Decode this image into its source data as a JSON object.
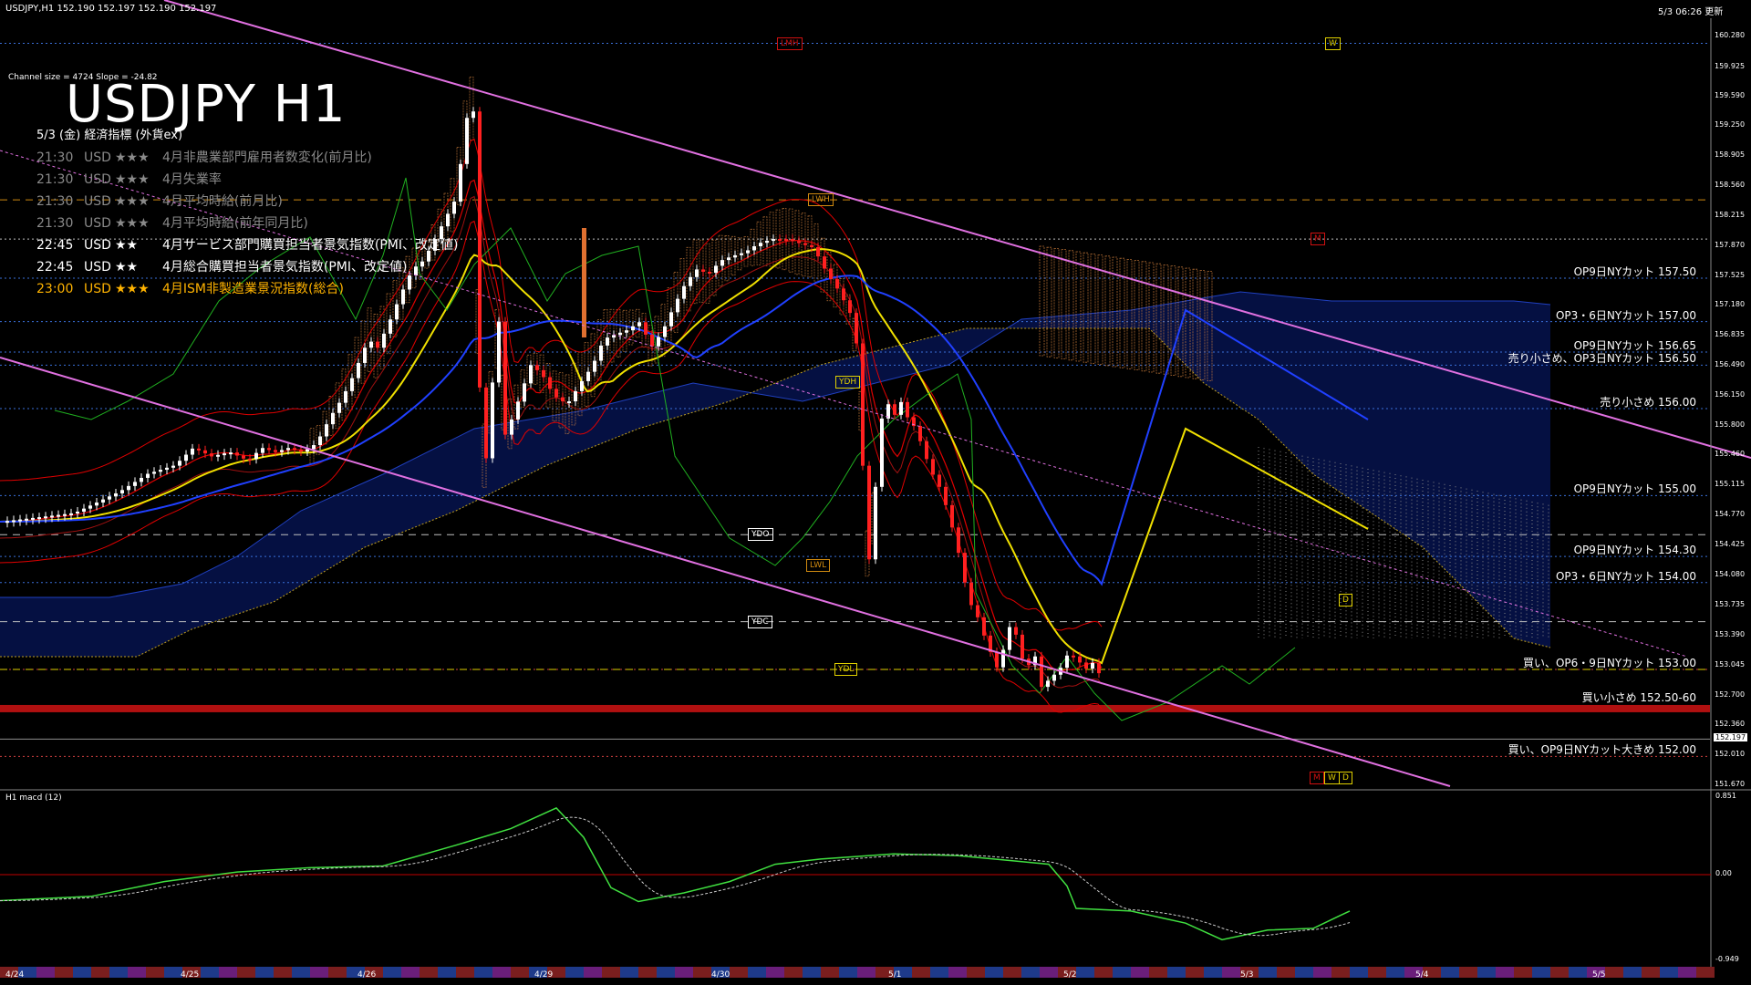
{
  "header": {
    "symbol_line": "USDJPY,H1  152.190 152.197 152.190 152.197",
    "updated": "5/3 06:26 更新"
  },
  "chart_title": "USDJPY H1",
  "channel_info": "Channel size = 4724 Slope = -24.82",
  "events": {
    "heading": "5/3 (金) 経済指標 (外貨ex)",
    "rows": [
      {
        "time": "21:30",
        "currency": "USD",
        "stars": "★★★",
        "name": "4月非農業部門雇用者数変化(前月比)",
        "state": "dim"
      },
      {
        "time": "21:30",
        "currency": "USD",
        "stars": "★★★",
        "name": "4月失業率",
        "state": "dim"
      },
      {
        "time": "21:30",
        "currency": "USD",
        "stars": "★★★",
        "name": "4月平均時給(前月比)",
        "state": "dim"
      },
      {
        "time": "21:30",
        "currency": "USD",
        "stars": "★★★",
        "name": "4月平均時給(前年同月比)",
        "state": "dim"
      },
      {
        "time": "22:45",
        "currency": "USD",
        "stars": "★★",
        "name": "4月サービス部門購買担当者景気指数(PMI、改定値)",
        "state": "bright"
      },
      {
        "time": "22:45",
        "currency": "USD",
        "stars": "★★",
        "name": "4月総合購買担当者景気指数(PMI、改定値)",
        "state": "bright"
      },
      {
        "time": "23:00",
        "currency": "USD",
        "stars": "★★★",
        "name": "4月ISM非製造業景況指数(総合)",
        "state": "amber"
      }
    ]
  },
  "order_labels": [
    {
      "price": 157.5,
      "text": "OP9日NYカット 157.50"
    },
    {
      "price": 157.0,
      "text": "OP3・6日NYカット 157.00"
    },
    {
      "price": 156.65,
      "text": "OP9日NYカット 156.65"
    },
    {
      "price": 156.5,
      "text": "売り小さめ、OP3日NYカット 156.50"
    },
    {
      "price": 156.0,
      "text": "売り小さめ 156.00"
    },
    {
      "price": 155.0,
      "text": "OP9日NYカット 155.00"
    },
    {
      "price": 154.3,
      "text": "OP9日NYカット 154.30"
    },
    {
      "price": 154.0,
      "text": "OP3・6日NYカット 154.00"
    },
    {
      "price": 153.0,
      "text": "買い、OP6・9日NYカット 153.00"
    },
    {
      "price": 152.6,
      "text": "買い小さめ 152.50-60"
    },
    {
      "price": 152.0,
      "text": "買い、OP9日NYカット大きめ 152.00"
    }
  ],
  "level_tags": [
    {
      "text": "LMH",
      "color": "#d01010",
      "price": 160.2
    },
    {
      "text": "LWH",
      "color": "#d08a10",
      "price": 158.4
    },
    {
      "text": "YDH",
      "color": "#e0d000",
      "price": 156.3
    },
    {
      "text": "YDO",
      "color": "#ffffff",
      "price": 154.55
    },
    {
      "text": "LWL",
      "color": "#d08a10",
      "price": 154.2
    },
    {
      "text": "YDC",
      "color": "#ffffff",
      "price": 153.55
    },
    {
      "text": "YDL",
      "color": "#e0d000",
      "price": 153.0
    },
    {
      "text": "W",
      "color": "#e0d000",
      "price": 160.2
    },
    {
      "text": "M",
      "color": "#d01010",
      "price": 157.95
    },
    {
      "text": "D",
      "color": "#e0d000",
      "price": 153.8
    },
    {
      "text": "M",
      "color": "#d01010",
      "price": 151.75
    },
    {
      "text": "W",
      "color": "#e0d000",
      "price": 151.75
    },
    {
      "text": "D",
      "color": "#e0d000",
      "price": 151.75
    }
  ],
  "current_price": "152.197",
  "macd": {
    "title": "H1  macd (12)",
    "ticks": [
      "0.851",
      "0.00",
      "-0.949"
    ]
  },
  "chart_data": {
    "type": "candlestick",
    "symbol": "USDJPY",
    "timeframe": "H1",
    "ylim": [
      151.7,
      160.3
    ],
    "price_ticks": [
      "160.280",
      "159.925",
      "159.590",
      "159.250",
      "158.905",
      "158.560",
      "158.215",
      "157.870",
      "157.525",
      "157.180",
      "156.835",
      "156.490",
      "156.150",
      "155.800",
      "155.460",
      "155.115",
      "154.770",
      "154.425",
      "154.080",
      "153.735",
      "153.390",
      "153.045",
      "152.700",
      "152.360",
      "152.010",
      "151.670"
    ],
    "x_ticks": [
      "4/24",
      "4/25",
      "4/26",
      "4/29",
      "4/30",
      "5/1",
      "5/2",
      "5/3",
      "5/4",
      "5/5"
    ],
    "close_path": [
      [
        0,
        154.7
      ],
      [
        40,
        154.75
      ],
      [
        80,
        154.8
      ],
      [
        100,
        154.9
      ],
      [
        130,
        155.05
      ],
      [
        160,
        155.25
      ],
      [
        190,
        155.35
      ],
      [
        210,
        155.55
      ],
      [
        230,
        155.45
      ],
      [
        250,
        155.5
      ],
      [
        270,
        155.4
      ],
      [
        285,
        155.55
      ],
      [
        300,
        155.5
      ],
      [
        315,
        155.55
      ],
      [
        330,
        155.5
      ],
      [
        345,
        155.6
      ],
      [
        360,
        155.9
      ],
      [
        372,
        156.1
      ],
      [
        382,
        156.3
      ],
      [
        392,
        156.55
      ],
      [
        402,
        156.8
      ],
      [
        412,
        156.7
      ],
      [
        425,
        157.0
      ],
      [
        437,
        157.3
      ],
      [
        450,
        157.6
      ],
      [
        462,
        157.7
      ],
      [
        475,
        157.95
      ],
      [
        487,
        158.2
      ],
      [
        497,
        158.4
      ],
      [
        505,
        158.95
      ],
      [
        512,
        159.5
      ],
      [
        518,
        159.4
      ],
      [
        523,
        156.4
      ],
      [
        530,
        155.3
      ],
      [
        537,
        156.2
      ],
      [
        545,
        157.0
      ],
      [
        552,
        155.7
      ],
      [
        560,
        155.9
      ],
      [
        570,
        156.2
      ],
      [
        580,
        156.5
      ],
      [
        592,
        156.4
      ],
      [
        605,
        156.15
      ],
      [
        620,
        156.05
      ],
      [
        635,
        156.3
      ],
      [
        648,
        156.5
      ],
      [
        660,
        156.8
      ],
      [
        672,
        156.85
      ],
      [
        685,
        156.9
      ],
      [
        700,
        157.0
      ],
      [
        712,
        156.7
      ],
      [
        725,
        156.9
      ],
      [
        738,
        157.2
      ],
      [
        750,
        157.45
      ],
      [
        762,
        157.6
      ],
      [
        775,
        157.55
      ],
      [
        788,
        157.7
      ],
      [
        800,
        157.75
      ],
      [
        815,
        157.8
      ],
      [
        830,
        157.9
      ],
      [
        845,
        157.95
      ],
      [
        860,
        157.95
      ],
      [
        875,
        157.9
      ],
      [
        890,
        157.85
      ],
      [
        905,
        157.55
      ],
      [
        918,
        157.35
      ],
      [
        930,
        157.1
      ],
      [
        940,
        156.6
      ],
      [
        947,
        154.4
      ],
      [
        953,
        154.2
      ],
      [
        958,
        155.1
      ],
      [
        963,
        155.8
      ],
      [
        970,
        156.1
      ],
      [
        978,
        155.9
      ],
      [
        985,
        156.1
      ],
      [
        993,
        155.9
      ],
      [
        1000,
        155.8
      ],
      [
        1008,
        155.6
      ],
      [
        1018,
        155.3
      ],
      [
        1028,
        155.1
      ],
      [
        1038,
        154.8
      ],
      [
        1050,
        154.3
      ],
      [
        1060,
        153.8
      ],
      [
        1070,
        153.6
      ],
      [
        1080,
        153.3
      ],
      [
        1092,
        153.0
      ],
      [
        1100,
        153.3
      ],
      [
        1108,
        153.6
      ],
      [
        1116,
        153.2
      ],
      [
        1124,
        153.0
      ],
      [
        1132,
        153.2
      ],
      [
        1140,
        152.8
      ],
      [
        1150,
        152.9
      ],
      [
        1160,
        153.0
      ],
      [
        1170,
        153.2
      ],
      [
        1180,
        153.1
      ],
      [
        1190,
        153.0
      ],
      [
        1198,
        153.1
      ],
      [
        1205,
        152.9
      ],
      [
        1210,
        152.2
      ]
    ]
  }
}
